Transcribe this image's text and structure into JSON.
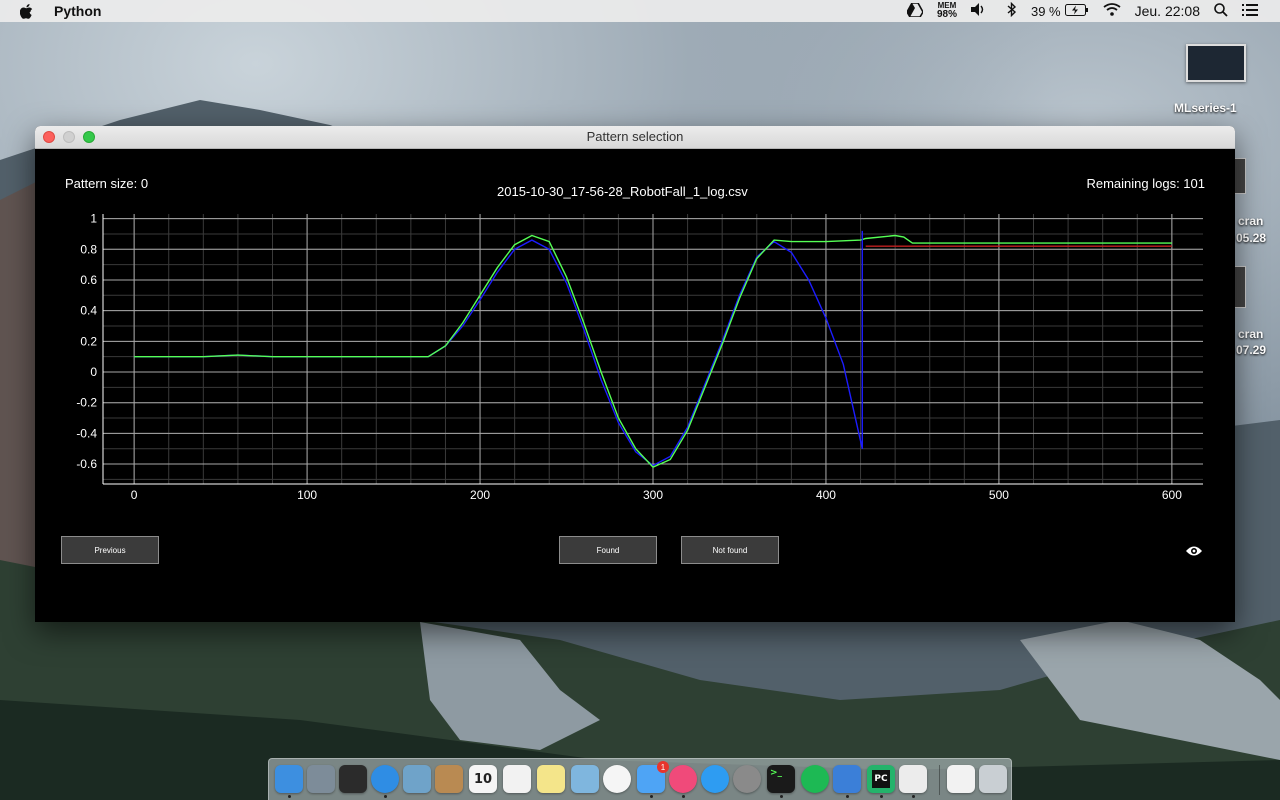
{
  "menubar": {
    "app_name": "Python",
    "mem_label": "MEM",
    "mem_value": "98%",
    "battery": "39 %",
    "clock": "Jeu. 22:08",
    "icons": [
      "apple-icon",
      "google-drive-icon",
      "volume-icon",
      "bluetooth-icon",
      "battery-icon",
      "wifi-icon",
      "search-icon",
      "list-icon"
    ]
  },
  "desktop": {
    "file_label": "MLseries-1",
    "side_fragments": [
      "cran",
      "05.28",
      "cran",
      "07.29"
    ]
  },
  "window": {
    "title": "Pattern selection",
    "pattern_size": "Pattern size: 0",
    "file_name": "2015-10-30_17-56-28_RobotFall_1_log.csv",
    "remaining_logs": "Remaining logs: 101",
    "buttons": {
      "previous": "Previous",
      "found": "Found",
      "not_found": "Not found"
    }
  },
  "chart_data": {
    "type": "line",
    "x_ticks": [
      "0",
      "100",
      "200",
      "300",
      "400",
      "500",
      "600"
    ],
    "y_ticks": [
      "1",
      "0.8",
      "0.6",
      "0.4",
      "0.2",
      "0",
      "-0.2",
      "-0.4",
      "-0.6"
    ],
    "xlim": [
      -18,
      618
    ],
    "ylim": [
      -0.73,
      1.03
    ],
    "grid": true,
    "colors": {
      "series_1": "#1c1cff",
      "series_2": "#55ff55",
      "series_3": "#c02020"
    },
    "series": [
      {
        "x": [
          0,
          20,
          40,
          60,
          80,
          100,
          120,
          140,
          160,
          170,
          180,
          190,
          200,
          210,
          220,
          230,
          240,
          250,
          260,
          270,
          280,
          290,
          300,
          310,
          320,
          330,
          340,
          350,
          360,
          370,
          380,
          390,
          400,
          410,
          418,
          421
        ],
        "values": [
          0.1,
          0.1,
          0.1,
          0.11,
          0.1,
          0.1,
          0.1,
          0.1,
          0.1,
          0.1,
          0.17,
          0.3,
          0.47,
          0.65,
          0.8,
          0.86,
          0.8,
          0.58,
          0.28,
          -0.05,
          -0.33,
          -0.52,
          -0.61,
          -0.55,
          -0.36,
          -0.08,
          0.2,
          0.5,
          0.75,
          0.85,
          0.78,
          0.6,
          0.35,
          0.05,
          -0.35,
          -0.5
        ]
      },
      {
        "x": [
          0,
          20,
          40,
          60,
          80,
          100,
          120,
          140,
          160,
          170,
          180,
          190,
          200,
          210,
          220,
          230,
          240,
          250,
          260,
          270,
          280,
          290,
          300,
          310,
          320,
          330,
          340,
          350,
          360,
          370,
          380,
          400,
          420,
          423,
          440,
          445,
          450,
          460,
          480,
          500,
          550,
          600
        ],
        "values": [
          0.1,
          0.1,
          0.1,
          0.11,
          0.1,
          0.1,
          0.1,
          0.1,
          0.1,
          0.1,
          0.17,
          0.32,
          0.5,
          0.68,
          0.83,
          0.89,
          0.85,
          0.62,
          0.32,
          0,
          -0.3,
          -0.5,
          -0.62,
          -0.57,
          -0.38,
          -0.1,
          0.18,
          0.48,
          0.74,
          0.86,
          0.85,
          0.85,
          0.86,
          0.87,
          0.89,
          0.88,
          0.84,
          0.84,
          0.84,
          0.84,
          0.84,
          0.84
        ]
      },
      {
        "x": [
          423,
          440,
          460,
          500,
          600
        ],
        "values": [
          0.82,
          0.82,
          0.82,
          0.82,
          0.82
        ]
      }
    ]
  },
  "dock": {
    "calendar_day": "10",
    "mail_badge": "1",
    "icons": [
      "finder-icon",
      "launchpad-icon",
      "dashboard-icon",
      "safari-icon",
      "preview-icon",
      "contacts-icon",
      "calendar-icon",
      "reminders-icon",
      "notes-icon",
      "photos-app-icon",
      "photos-icon",
      "messages-icon",
      "itunes-icon",
      "app-store-icon",
      "system-preferences-icon",
      "terminal-icon",
      "spotify-icon",
      "keynote-icon",
      "pycharm-icon",
      "inkscape-icon",
      "files-icon",
      "trash-icon"
    ]
  }
}
